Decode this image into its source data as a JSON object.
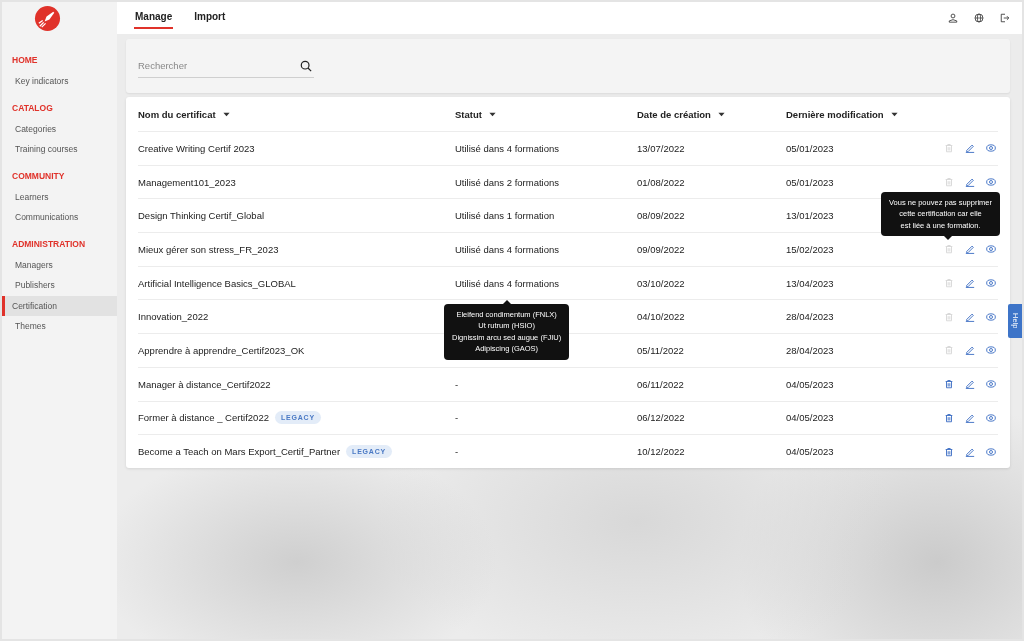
{
  "sidebar": {
    "sections": [
      {
        "title": "HOME",
        "items": [
          {
            "label": "Key indicators",
            "selected": false
          }
        ]
      },
      {
        "title": "CATALOG",
        "items": [
          {
            "label": "Categories",
            "selected": false
          },
          {
            "label": "Training courses",
            "selected": false
          }
        ]
      },
      {
        "title": "COMMUNITY",
        "items": [
          {
            "label": "Learners",
            "selected": false
          },
          {
            "label": "Communications",
            "selected": false
          }
        ]
      },
      {
        "title": "ADMINISTRATION",
        "items": [
          {
            "label": "Managers",
            "selected": false
          },
          {
            "label": "Publishers",
            "selected": false
          },
          {
            "label": "Certification",
            "selected": true
          },
          {
            "label": "Themes",
            "selected": false
          }
        ]
      }
    ]
  },
  "tabs": [
    {
      "label": "Manage",
      "selected": true
    },
    {
      "label": "Import",
      "selected": false
    }
  ],
  "search": {
    "placeholder": "Rechercher"
  },
  "table": {
    "columns": [
      "Nom du certificat",
      "Statut",
      "Date de création",
      "Dernière modification"
    ],
    "rows": [
      {
        "name": "Creative Writing Certif 2023",
        "status": "Utilisé dans 4 formations",
        "created": "13/07/2022",
        "modified": "05/01/2023",
        "delete_disabled": true
      },
      {
        "name": "Management101_2023",
        "status": "Utilisé dans 2 formations",
        "created": "01/08/2022",
        "modified": "05/01/2023",
        "delete_disabled": true
      },
      {
        "name": "Design Thinking Certif_Global",
        "status": "Utilisé dans 1 formation",
        "created": "08/09/2022",
        "modified": "13/01/2023"
      },
      {
        "name": "Mieux gérer son stress_FR_2023",
        "status": "Utilisé dans 4 formations",
        "created": "09/09/2022",
        "modified": "15/02/2023",
        "delete_disabled": true,
        "delete_tooltip": [
          "Vous ne pouvez pas supprimer",
          "cette certification car elle",
          "est liée à une formation."
        ]
      },
      {
        "name": "Artificial Intelligence Basics_GLOBAL",
        "status": "Utilisé dans 4 formations",
        "created": "03/10/2022",
        "modified": "13/04/2023",
        "delete_disabled": true,
        "status_tooltip": [
          "Eleifend condimentum (FNLX)",
          "Ut rutrum (HSIO)",
          "Dignissim arcu sed augue (FJIU)",
          "Adipiscing (GAOS)"
        ]
      },
      {
        "name": "Innovation_2022",
        "created": "04/10/2022",
        "modified": "28/04/2023",
        "delete_disabled": true
      },
      {
        "name": "Apprendre à apprendre_Certif2023_OK",
        "created": "05/11/2022",
        "modified": "28/04/2023",
        "delete_disabled": true
      },
      {
        "name": "Manager à distance_Certif2022",
        "status": "-",
        "created": "06/11/2022",
        "modified": "04/05/2023",
        "delete_disabled": false
      },
      {
        "name": "Former à distance _ Certif2022",
        "tag": "LEGACY",
        "status": "-",
        "created": "06/12/2022",
        "modified": "04/05/2023",
        "delete_disabled": false
      },
      {
        "name": "Become a Teach on Mars Export_Certif_Partner",
        "tag": "LEGACY",
        "status": "-",
        "created": "10/12/2022",
        "modified": "04/05/2023",
        "delete_disabled": false
      }
    ]
  },
  "help_tab": {
    "label": "Help"
  }
}
